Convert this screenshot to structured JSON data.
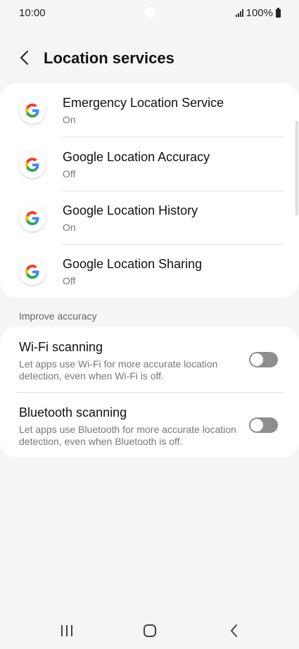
{
  "status_bar": {
    "time": "10:00",
    "battery": "100%",
    "icons": [
      "signal-icon",
      "battery-icon"
    ]
  },
  "header": {
    "title": "Location services",
    "back_icon": "chevron-left-icon"
  },
  "services": [
    {
      "title": "Emergency Location Service",
      "status": "On",
      "icon": "google-icon"
    },
    {
      "title": "Google Location Accuracy",
      "status": "Off",
      "icon": "google-icon"
    },
    {
      "title": "Google Location History",
      "status": "On",
      "icon": "google-icon"
    },
    {
      "title": "Google Location Sharing",
      "status": "Off",
      "icon": "google-icon"
    }
  ],
  "improve_accuracy": {
    "section_label": "Improve accuracy",
    "items": [
      {
        "title": "Wi-Fi scanning",
        "description": "Let apps use Wi-Fi for more accurate location detection, even when Wi-Fi is off.",
        "enabled": false
      },
      {
        "title": "Bluetooth scanning",
        "description": "Let apps use Bluetooth for more accurate location detection, even when Bluetooth is off.",
        "enabled": false
      }
    ]
  },
  "nav_bar": {
    "icons": [
      "recent-apps-icon",
      "home-icon",
      "back-icon"
    ]
  },
  "colors": {
    "background": "#f5f5f5",
    "card": "#ffffff",
    "toggle_off": "#8e8e8e",
    "google_blue": "#4285F4",
    "google_red": "#EA4335",
    "google_yellow": "#FBBC05",
    "google_green": "#34A853"
  }
}
